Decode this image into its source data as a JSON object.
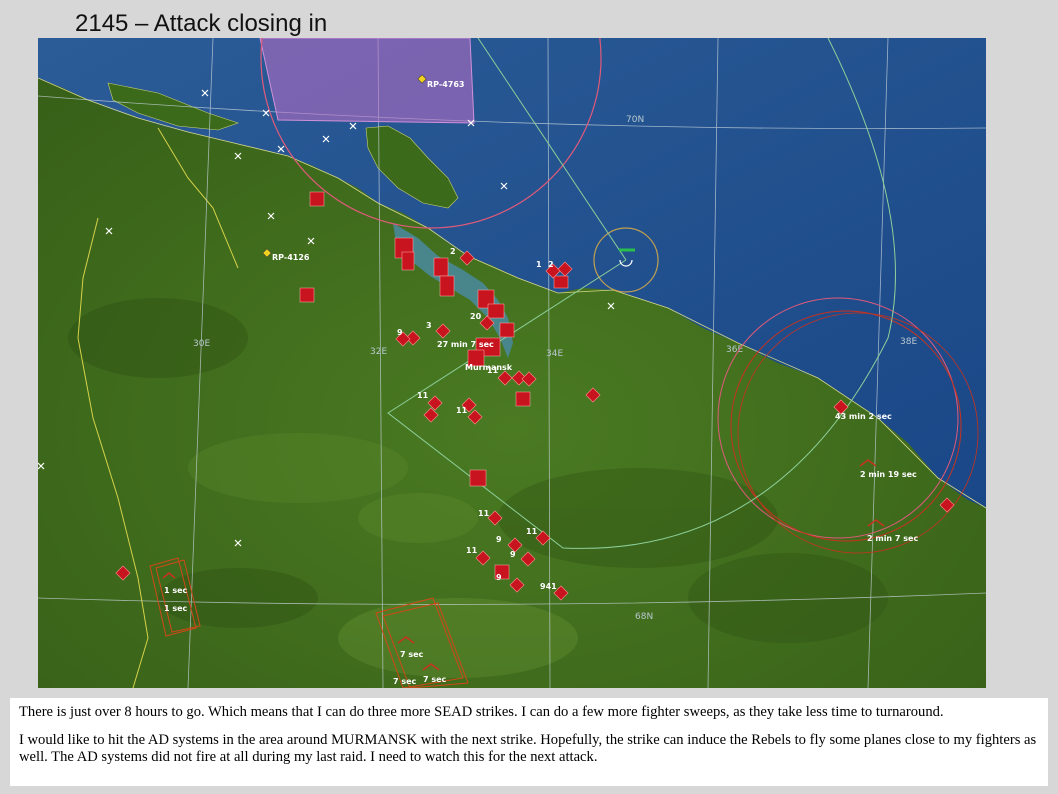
{
  "slide": {
    "title": "2145 – Attack closing in"
  },
  "map": {
    "reference_points": [
      {
        "label": "RP-4763"
      },
      {
        "label": "RP-4126"
      }
    ],
    "grid_labels": {
      "lat_70": "70N",
      "lat_68": "68N",
      "lon_30": "30E",
      "lon_32": "32E",
      "lon_34": "34E",
      "lon_36": "36E",
      "lon_38": "38E"
    },
    "city": "Murmansk",
    "timers": {
      "t1": "27 min 7 sec",
      "t2": "43 min 2 sec",
      "t3": "2 min 19 sec",
      "t4": "2 min 7 sec",
      "t5": "1 sec",
      "t6": "1 sec",
      "t7": "7 sec",
      "t8": "7 sec",
      "t9": "7 sec"
    },
    "unit_counts": {
      "c1": "1",
      "c2": "2",
      "c3": "2",
      "c4": "9",
      "c5": "3",
      "c6": "20",
      "c7": "11",
      "c8": "11",
      "c9": "9",
      "c10": "11",
      "c11": "11",
      "c12": "9",
      "c13": "11",
      "c14": "9",
      "c15": "941",
      "c16": "11"
    },
    "colors": {
      "sea": "#1f4f8f",
      "land": "#3f6b1c",
      "hostile": "#c8141e",
      "grid": "#c8d4dc",
      "range_ring": "#e05a7a",
      "patrol_zone": "#c070c8"
    }
  },
  "notes": {
    "paragraph_1": "There is just over 8 hours to go.  Which means that I can do three more SEAD strikes.  I can do a few more fighter sweeps, as they take less time to turnaround.",
    "paragraph_2": "I would like to hit the AD systems in the area around MURMANSK with the next strike.  Hopefully, the strike can induce the Rebels to fly some planes close to my fighters as well.  The AD systems did not fire at all during my last raid.  I need to watch this for the next attack."
  }
}
